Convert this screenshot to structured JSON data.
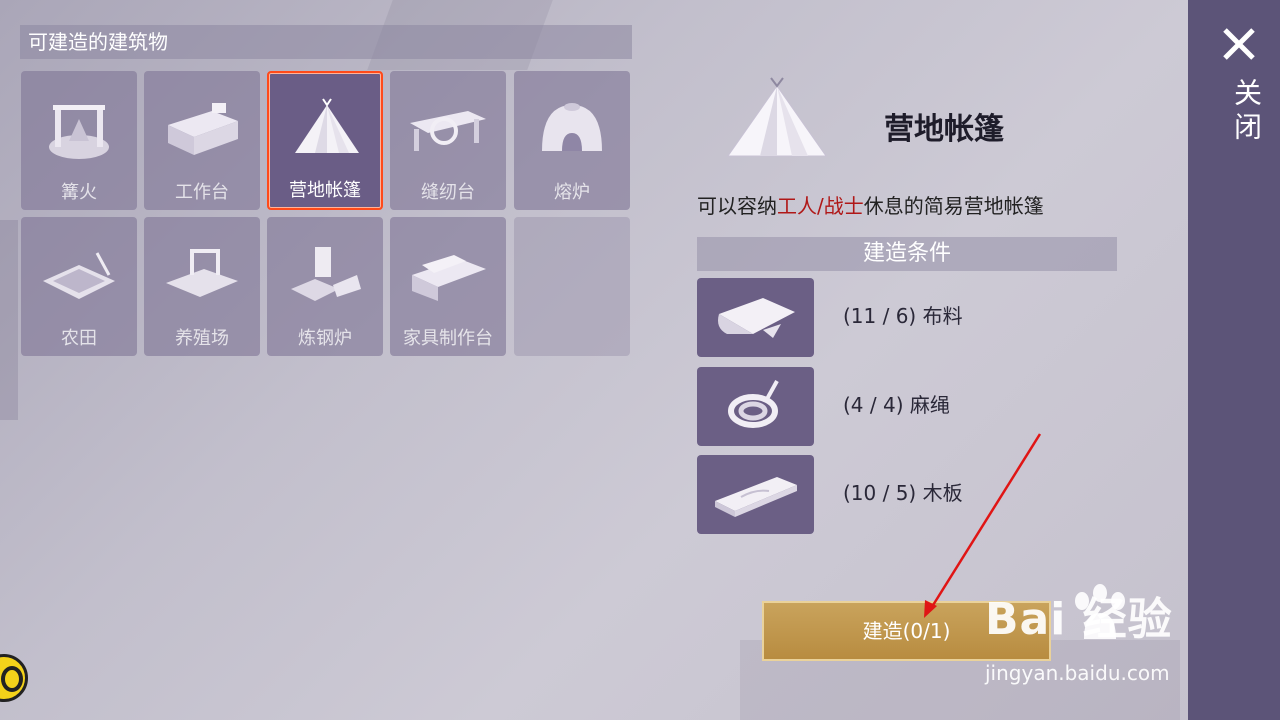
{
  "panel": {
    "section_title": "可建造的建筑物",
    "buildings": [
      {
        "label": "篝火",
        "icon": "campfire-icon"
      },
      {
        "label": "工作台",
        "icon": "workbench-icon"
      },
      {
        "label": "营地帐篷",
        "icon": "tent-icon",
        "selected": true
      },
      {
        "label": "缝纫台",
        "icon": "sewing-table-icon"
      },
      {
        "label": "熔炉",
        "icon": "furnace-icon"
      },
      {
        "label": "农田",
        "icon": "farmland-icon"
      },
      {
        "label": "养殖场",
        "icon": "ranch-icon"
      },
      {
        "label": "炼钢炉",
        "icon": "steel-furnace-icon"
      },
      {
        "label": "家具制作台",
        "icon": "furniture-bench-icon"
      },
      {
        "label": "",
        "icon": ""
      }
    ]
  },
  "detail": {
    "title": "营地帐篷",
    "desc_prefix": "可以容纳",
    "desc_highlight": "工人/战士",
    "desc_suffix": "休息的简易营地帐篷",
    "conditions_header": "建造条件",
    "materials": [
      {
        "text": "(11 / 6) 布料",
        "icon": "cloth-icon"
      },
      {
        "text": "(4 / 4) 麻绳",
        "icon": "rope-icon"
      },
      {
        "text": "(10 / 5) 木板",
        "icon": "plank-icon"
      }
    ],
    "build_button": "建造(0/1)"
  },
  "close_label": "关闭",
  "watermark": {
    "brand": "Bai  经验",
    "url": "jingyan.baidu.com"
  },
  "colors": {
    "accent": "#ff4a1a",
    "highlight_text": "#b01818",
    "button": "#c9a35c",
    "sidebar": "#5c5478"
  }
}
